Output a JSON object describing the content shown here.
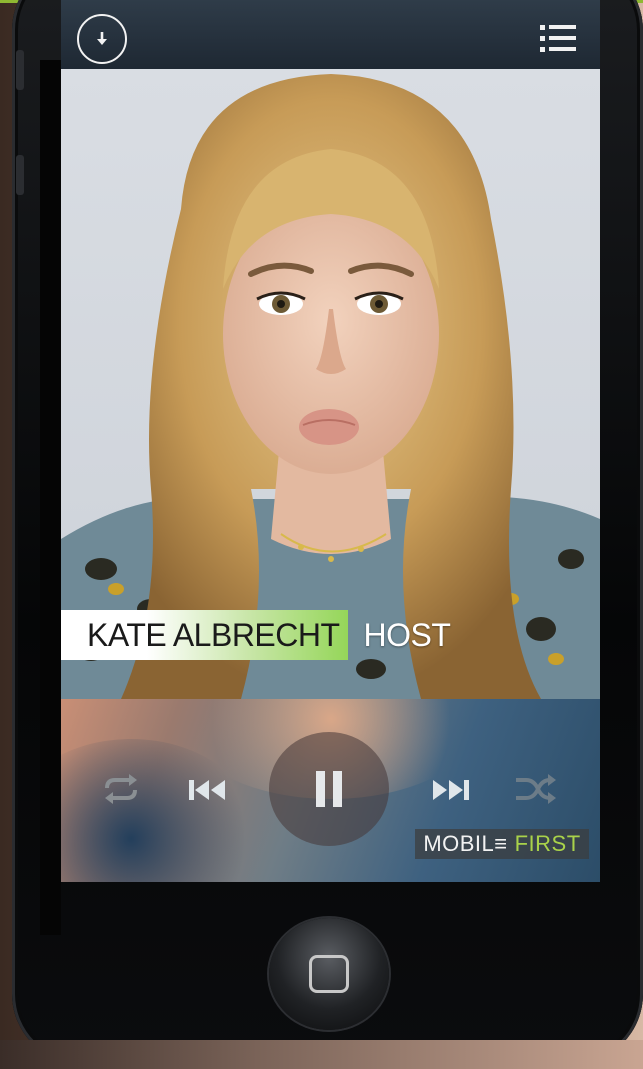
{
  "nav": {
    "title": "",
    "download_icon": "download-arrow-icon",
    "menu_icon": "list-menu-icon"
  },
  "hero": {
    "name": "KATE ALBRECHT",
    "role": "HOST",
    "name_highlight_color": "#95d659"
  },
  "player": {
    "controls": [
      "repeat-icon",
      "previous-icon",
      "pause-icon",
      "next-icon",
      "shuffle-icon"
    ],
    "brand_word1": "MOBIL≡",
    "brand_word2": "FIRST",
    "brand_accent_color": "#a9d24a"
  },
  "device": {
    "home_button_icon": "home-square-icon"
  }
}
